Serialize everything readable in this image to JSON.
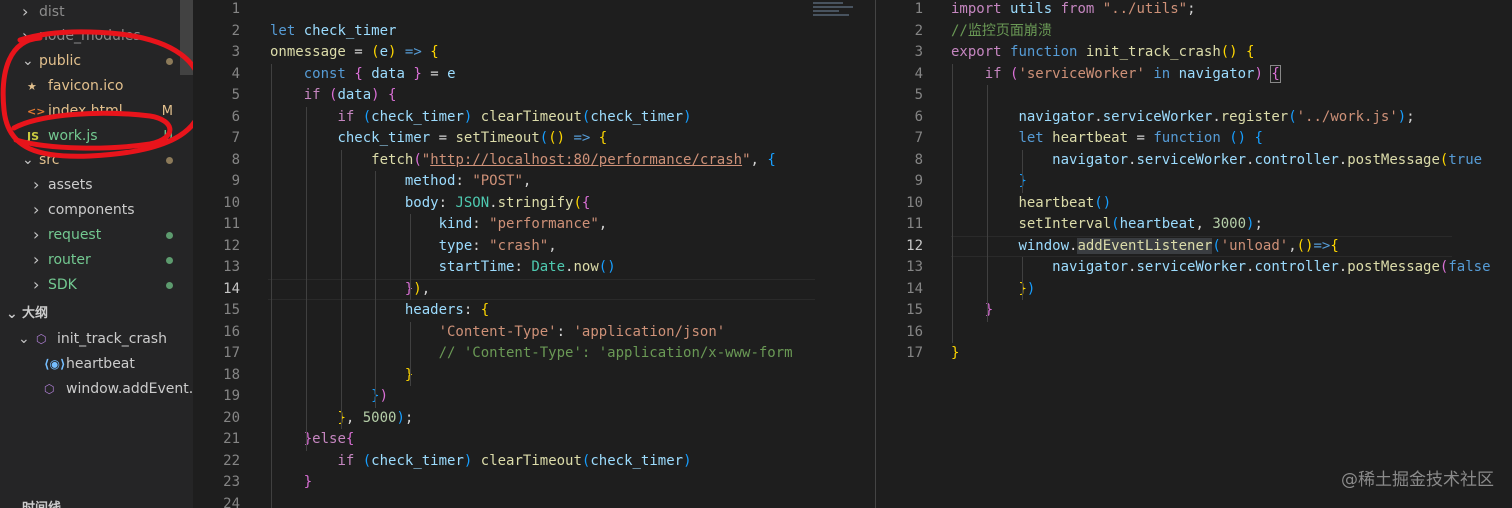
{
  "explorer": {
    "items": [
      {
        "label": "dist",
        "color": "#8c8c8c"
      },
      {
        "label": "node_modules",
        "color": "#8c8c8c"
      },
      {
        "label": "public",
        "color": "#e2c08d",
        "badge_color": "#8c7a59"
      },
      {
        "label": "favicon.ico",
        "color": "#e2c08d",
        "icon": "★"
      },
      {
        "label": "index.html",
        "color": "#e2c08d",
        "badge": "M",
        "icon": "<>"
      },
      {
        "label": "work.js",
        "color": "#73c991",
        "badge": "U",
        "icon": "JS"
      },
      {
        "label": "src",
        "color": "#e2c08d",
        "badge_color": "#8c7a59"
      },
      {
        "label": "assets",
        "color": "#cccccc"
      },
      {
        "label": "components",
        "color": "#cccccc"
      },
      {
        "label": "request",
        "color": "#73c991",
        "badge_color": "#5d9b6e"
      },
      {
        "label": "router",
        "color": "#73c991",
        "badge_color": "#5d9b6e"
      },
      {
        "label": "SDK",
        "color": "#73c991",
        "badge_color": "#5d9b6e"
      }
    ]
  },
  "outline": {
    "title": "大纲",
    "items": [
      {
        "label": "init_track_crash"
      },
      {
        "label": "heartbeat"
      },
      {
        "label": "window.addEvent..."
      }
    ],
    "timeline_title": "时间线"
  },
  "left_editor": {
    "active_line": 14,
    "lines": [
      {
        "n": "1",
        "html": ""
      },
      {
        "n": "2",
        "html": "<span class='k'>let</span> <span class='v'>check_timer</span>"
      },
      {
        "n": "3",
        "html": "<span class='f'>onmessage</span> <span class='p'>=</span> <span class='b1'>(</span><span class='v'>e</span><span class='b1'>)</span> <span class='k'>=&gt;</span> <span class='b1'>{</span>"
      },
      {
        "n": "4",
        "html": "    <span class='k'>const</span> <span class='b2'>{</span> <span class='v'>data</span> <span class='b2'>}</span> <span class='p'>=</span> <span class='v'>e</span>"
      },
      {
        "n": "5",
        "html": "    <span class='kc'>if</span> <span class='b2'>(</span><span class='v'>data</span><span class='b2'>)</span> <span class='b2'>{</span>"
      },
      {
        "n": "6",
        "html": "        <span class='kc'>if</span> <span class='b3'>(</span><span class='v'>check_timer</span><span class='b3'>)</span> <span class='f'>clearTimeout</span><span class='b3'>(</span><span class='v'>check_timer</span><span class='b3'>)</span>"
      },
      {
        "n": "7",
        "html": "        <span class='v'>check_timer</span> <span class='p'>=</span> <span class='f'>setTimeout</span><span class='b3'>(</span><span class='b1'>()</span> <span class='k'>=&gt;</span> <span class='b1'>{</span>"
      },
      {
        "n": "8",
        "html": "            <span class='f'>fetch</span><span class='b2'>(</span><span class='s'>\"<span class='u'>http://localhost:80/performance/crash</span>\"</span><span class='p'>,</span> <span class='b3'>{</span>"
      },
      {
        "n": "9",
        "html": "                <span class='v'>method</span><span class='p'>:</span> <span class='s'>\"POST\"</span><span class='p'>,</span>"
      },
      {
        "n": "10",
        "html": "                <span class='v'>body</span><span class='p'>:</span> <span class='t'>JSON</span><span class='p'>.</span><span class='f'>stringify</span><span class='b1'>(</span><span class='b2'>{</span>"
      },
      {
        "n": "11",
        "html": "                    <span class='v'>kind</span><span class='p'>:</span> <span class='s'>\"performance\"</span><span class='p'>,</span>"
      },
      {
        "n": "12",
        "html": "                    <span class='v'>type</span><span class='p'>:</span> <span class='s'>\"crash\"</span><span class='p'>,</span>"
      },
      {
        "n": "13",
        "html": "                    <span class='v'>startTime</span><span class='p'>:</span> <span class='t'>Date</span><span class='p'>.</span><span class='f'>now</span><span class='b3'>()</span>"
      },
      {
        "n": "14",
        "html": "                <span class='b2'>}</span><span class='b1'>)</span><span class='p'>,</span>"
      },
      {
        "n": "15",
        "html": "                <span class='v'>headers</span><span class='p'>:</span> <span class='b1'>{</span>"
      },
      {
        "n": "16",
        "html": "                    <span class='s'>'Content-Type'</span><span class='p'>:</span> <span class='s'>'application/json'</span>"
      },
      {
        "n": "17",
        "html": "                    <span class='c'>// 'Content-Type': 'application/x-www-form</span>"
      },
      {
        "n": "18",
        "html": "                <span class='b1'>}</span>"
      },
      {
        "n": "19",
        "html": "            <span class='b3'>}</span><span class='b2'>)</span>"
      },
      {
        "n": "20",
        "html": "        <span class='b1'>}</span><span class='p'>,</span> <span class='n'>5000</span><span class='b3'>)</span><span class='p'>;</span>"
      },
      {
        "n": "21",
        "html": "    <span class='b2'>}</span><span class='kc'>else</span><span class='b2'>{</span>"
      },
      {
        "n": "22",
        "html": "        <span class='kc'>if</span> <span class='b3'>(</span><span class='v'>check_timer</span><span class='b3'>)</span> <span class='f'>clearTimeout</span><span class='b3'>(</span><span class='v'>check_timer</span><span class='b3'>)</span>"
      },
      {
        "n": "23",
        "html": "    <span class='b2'>}</span>"
      },
      {
        "n": "24",
        "html": ""
      }
    ]
  },
  "right_editor": {
    "active_line": 12,
    "lines": [
      {
        "n": "1",
        "html": "<span class='kc'>import</span> <span class='v'>utils</span> <span class='kc'>from</span> <span class='s'>\"../utils\"</span><span class='p'>;</span>"
      },
      {
        "n": "2",
        "html": "<span class='c'>//监控页面崩溃</span>"
      },
      {
        "n": "3",
        "html": "<span class='kc'>export</span> <span class='k'>function</span> <span class='f'>init_track_crash</span><span class='b1'>()</span> <span class='b1'>{</span>"
      },
      {
        "n": "4",
        "html": "    <span class='kc'>if</span> <span class='b2'>(</span><span class='s'>'serviceWorker'</span> <span class='k'>in</span> <span class='v'>navigator</span><span class='b2'>)</span> <span class='b2' style='outline:1px solid #888'>{</span>"
      },
      {
        "n": "5",
        "html": ""
      },
      {
        "n": "6",
        "html": "        <span class='v'>navigator</span><span class='p'>.</span><span class='v'>serviceWorker</span><span class='p'>.</span><span class='f'>register</span><span class='b3'>(</span><span class='s'>'../work.js'</span><span class='b3'>)</span><span class='p'>;</span>"
      },
      {
        "n": "7",
        "html": "        <span class='k'>let</span> <span class='f'>heartbeat</span> <span class='p'>=</span> <span class='k'>function</span> <span class='b3'>()</span> <span class='b3'>{</span>"
      },
      {
        "n": "8",
        "html": "            <span class='v'>navigator</span><span class='p'>.</span><span class='v'>serviceWorker</span><span class='p'>.</span><span class='v'>controller</span><span class='p'>.</span><span class='f'>postMessage</span><span class='b1'>(</span><span class='k'>true</span>"
      },
      {
        "n": "9",
        "html": "        <span class='b3'>}</span>"
      },
      {
        "n": "10",
        "html": "        <span class='f'>heartbeat</span><span class='b3'>()</span>"
      },
      {
        "n": "11",
        "html": "        <span class='f'>setInterval</span><span class='b3'>(</span><span class='v'>heartbeat</span><span class='p'>,</span> <span class='n'>3000</span><span class='b3'>)</span><span class='p'>;</span>"
      },
      {
        "n": "12",
        "html": "        <span class='v'>window</span><span class='p'>.</span><span class='f' style='background:#3a3d41'>addEventListener</span><span class='b3'>(</span><span class='s'>'unload'</span><span class='p'>,</span><span class='b1'>()</span><span class='k'>=&gt;</span><span class='b1'>{</span>"
      },
      {
        "n": "13",
        "html": "            <span class='v'>navigator</span><span class='p'>.</span><span class='v'>serviceWorker</span><span class='p'>.</span><span class='v'>controller</span><span class='p'>.</span><span class='f'>postMessage</span><span class='b2'>(</span><span class='k'>false</span>"
      },
      {
        "n": "14",
        "html": "        <span class='b1'>}</span><span class='b3'>)</span>"
      },
      {
        "n": "15",
        "html": "    <span class='b2'>}</span>"
      },
      {
        "n": "16",
        "html": ""
      },
      {
        "n": "17",
        "html": "<span class='b1'>}</span>"
      }
    ]
  },
  "watermark": "@稀土掘金技术社区",
  "colors": {
    "annotation": "#e8141b",
    "editor_bg": "#1e1e1e",
    "sidebar_bg": "#252526"
  }
}
